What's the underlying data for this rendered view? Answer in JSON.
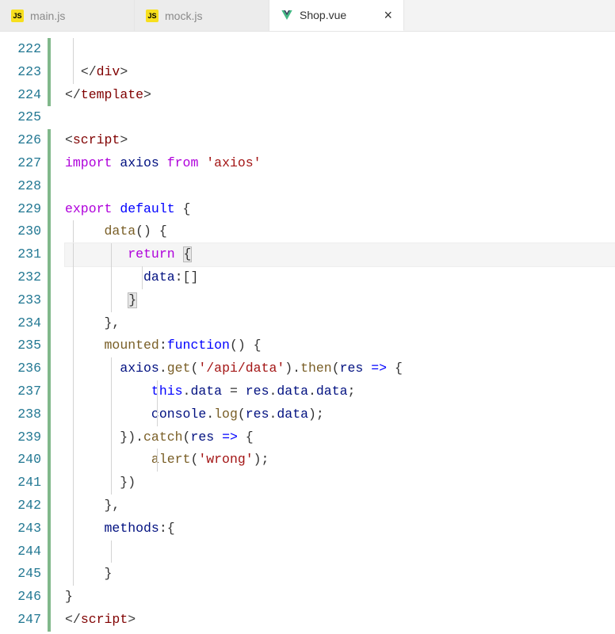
{
  "tabs": [
    {
      "id": "tab-mainjs",
      "label": "main.js",
      "icon": "js",
      "active": false
    },
    {
      "id": "tab-mockjs",
      "label": "mock.js",
      "icon": "js",
      "active": false
    },
    {
      "id": "tab-shopvue",
      "label": "Shop.vue",
      "icon": "vue",
      "active": true,
      "closeGlyph": "×"
    }
  ],
  "closeLabel": "×",
  "startLine": 222,
  "currentLine": 231,
  "modifiedSegments": [
    [
      222,
      224
    ],
    [
      226,
      247
    ]
  ],
  "tokens": {
    "div": "div",
    "template": "template",
    "script": "script",
    "import": "import",
    "axios": "axios",
    "from": "from",
    "axiosStr": "'axios'",
    "export": "export",
    "default": "default",
    "data": "data",
    "return": "return",
    "dataProp": "data",
    "emptyArr": "[]",
    "mounted": "mounted",
    "function": "function",
    "get": "get",
    "apiStr": "'/api/data'",
    "then": "then",
    "res": "res",
    "this": "this",
    "console": "console",
    "log": "log",
    "catch": "catch",
    "alert": "alert",
    "wrongStr": "'wrong'",
    "methods": "methods"
  },
  "lineNumbers": [
    "222",
    "223",
    "224",
    "225",
    "226",
    "227",
    "228",
    "229",
    "230",
    "231",
    "232",
    "233",
    "234",
    "235",
    "236",
    "237",
    "238",
    "239",
    "240",
    "241",
    "242",
    "243",
    "244",
    "245",
    "246",
    "247"
  ]
}
